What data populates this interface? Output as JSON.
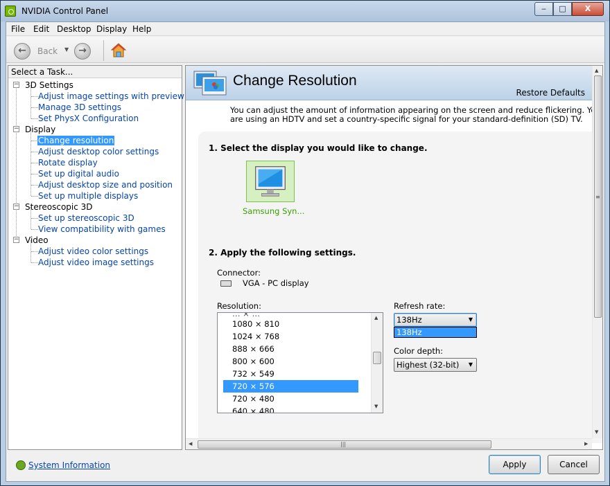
{
  "window": {
    "title": "NVIDIA Control Panel",
    "minimize_glyph": "‒",
    "maximize_glyph": "□",
    "close_glyph": "X"
  },
  "menu": [
    "File",
    "Edit",
    "Desktop",
    "Display",
    "Help"
  ],
  "toolbar": {
    "back_label": "Back",
    "back_glyph": "←",
    "forward_glyph": "→",
    "dropdown_glyph": "▼"
  },
  "task_pane": {
    "header": "Select a Task...",
    "categories": [
      {
        "label": "3D Settings",
        "items": [
          "Adjust image settings with preview",
          "Manage 3D settings",
          "Set PhysX Configuration"
        ]
      },
      {
        "label": "Display",
        "items": [
          "Change resolution",
          "Adjust desktop color settings",
          "Rotate display",
          "Set up digital audio",
          "Adjust desktop size and position",
          "Set up multiple displays"
        ]
      },
      {
        "label": "Stereoscopic 3D",
        "items": [
          "Set up stereoscopic 3D",
          "View compatibility with games"
        ]
      },
      {
        "label": "Video",
        "items": [
          "Adjust video color settings",
          "Adjust video image settings"
        ]
      }
    ],
    "collapse_glyph": "−",
    "selected_item": "Change resolution"
  },
  "footer": {
    "system_info": "System Information",
    "apply": "Apply",
    "cancel": "Cancel"
  },
  "content": {
    "title": "Change Resolution",
    "restore_defaults": "Restore Defaults",
    "description_line1": "You can adjust the amount of information appearing on the screen and reduce flickering. You can also choose t",
    "description_line2": "are using an HDTV and set a country-specific signal for your standard-definition (SD) TV.",
    "step1": "1. Select the display you would like to change.",
    "display_name": "Samsung Syn...",
    "step2": "2. Apply the following settings.",
    "connector_label": "Connector:",
    "connector_value": "VGA - PC display",
    "resolution_label": "Resolution:",
    "resolutions": [
      "1080 × 810",
      "1024 × 768",
      "888 × 666",
      "800 × 600",
      "732 × 549",
      "720 × 576",
      "720 × 480",
      "640 × 480"
    ],
    "selected_resolution": "720 × 576",
    "refresh_label": "Refresh rate:",
    "refresh_value": "138Hz",
    "refresh_options": [
      "138Hz"
    ],
    "color_depth_label": "Color depth:",
    "color_depth_value": "Highest (32-bit)",
    "scroll_up_glyph": "▲",
    "scroll_down_glyph": "▼",
    "scroll_left_glyph": "◀",
    "scroll_right_glyph": "▶",
    "grip_glyph": "≡",
    "hgrip_glyph": "|||"
  }
}
